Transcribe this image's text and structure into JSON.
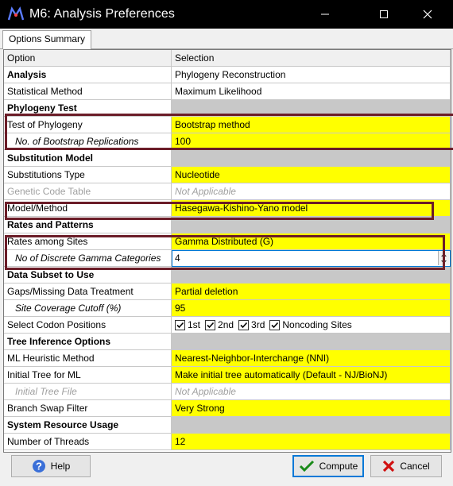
{
  "window": {
    "title": "M6: Analysis Preferences",
    "controls": [
      "minimize",
      "maximize",
      "close"
    ]
  },
  "tabs": [
    {
      "label": "Options Summary",
      "active": true
    }
  ],
  "grid": {
    "headers": {
      "option": "Option",
      "selection": "Selection"
    },
    "rows": [
      {
        "option": "Analysis",
        "selection": "Phylogeny Reconstruction",
        "kind": "section-valued"
      },
      {
        "option": "Statistical Method",
        "selection": "Maximum Likelihood",
        "kind": "plain"
      },
      {
        "option": "Phylogeny Test",
        "selection": "",
        "kind": "section"
      },
      {
        "option": "Test of Phylogeny",
        "selection": "Bootstrap method",
        "kind": "editable"
      },
      {
        "option": "No. of Bootstrap Replications",
        "selection": "100",
        "kind": "editable-sub"
      },
      {
        "option": "Substitution Model",
        "selection": "",
        "kind": "section"
      },
      {
        "option": "Substitutions Type",
        "selection": "Nucleotide",
        "kind": "editable"
      },
      {
        "option": "Genetic Code Table",
        "selection": "Not Applicable",
        "kind": "disabled"
      },
      {
        "option": "Model/Method",
        "selection": "Hasegawa-Kishino-Yano model",
        "kind": "editable"
      },
      {
        "option": "Rates and Patterns",
        "selection": "",
        "kind": "section"
      },
      {
        "option": "Rates among Sites",
        "selection": "Gamma Distributed (G)",
        "kind": "editable"
      },
      {
        "option": "No of Discrete Gamma Categories",
        "selection": "4",
        "kind": "spin-sub"
      },
      {
        "option": "Data Subset to Use",
        "selection": "",
        "kind": "section"
      },
      {
        "option": "Gaps/Missing Data Treatment",
        "selection": "Partial deletion",
        "kind": "editable"
      },
      {
        "option": "Site Coverage Cutoff (%)",
        "selection": "95",
        "kind": "editable-sub"
      },
      {
        "option": "Select Codon Positions",
        "selection": "",
        "kind": "checkboxes"
      },
      {
        "option": "Tree Inference Options",
        "selection": "",
        "kind": "section"
      },
      {
        "option": "ML Heuristic Method",
        "selection": "Nearest-Neighbor-Interchange (NNI)",
        "kind": "editable"
      },
      {
        "option": "Initial Tree for ML",
        "selection": "Make initial tree automatically (Default - NJ/BioNJ)",
        "kind": "editable"
      },
      {
        "option": "Initial Tree File",
        "selection": "Not Applicable",
        "kind": "disabled-sub"
      },
      {
        "option": "Branch Swap Filter",
        "selection": "Very Strong",
        "kind": "editable"
      },
      {
        "option": "System Resource Usage",
        "selection": "",
        "kind": "section"
      },
      {
        "option": "Number of Threads",
        "selection": "12",
        "kind": "editable"
      }
    ]
  },
  "codon_positions": [
    {
      "label": "1st",
      "checked": true
    },
    {
      "label": "2nd",
      "checked": true
    },
    {
      "label": "3rd",
      "checked": true
    },
    {
      "label": "Noncoding Sites",
      "checked": true
    }
  ],
  "buttons": {
    "help": "Help",
    "compute": "Compute",
    "cancel": "Cancel"
  },
  "colors": {
    "highlight": "#ffff00",
    "annotation_box": "#6b1d28",
    "section_fill": "#c8c8c8"
  }
}
